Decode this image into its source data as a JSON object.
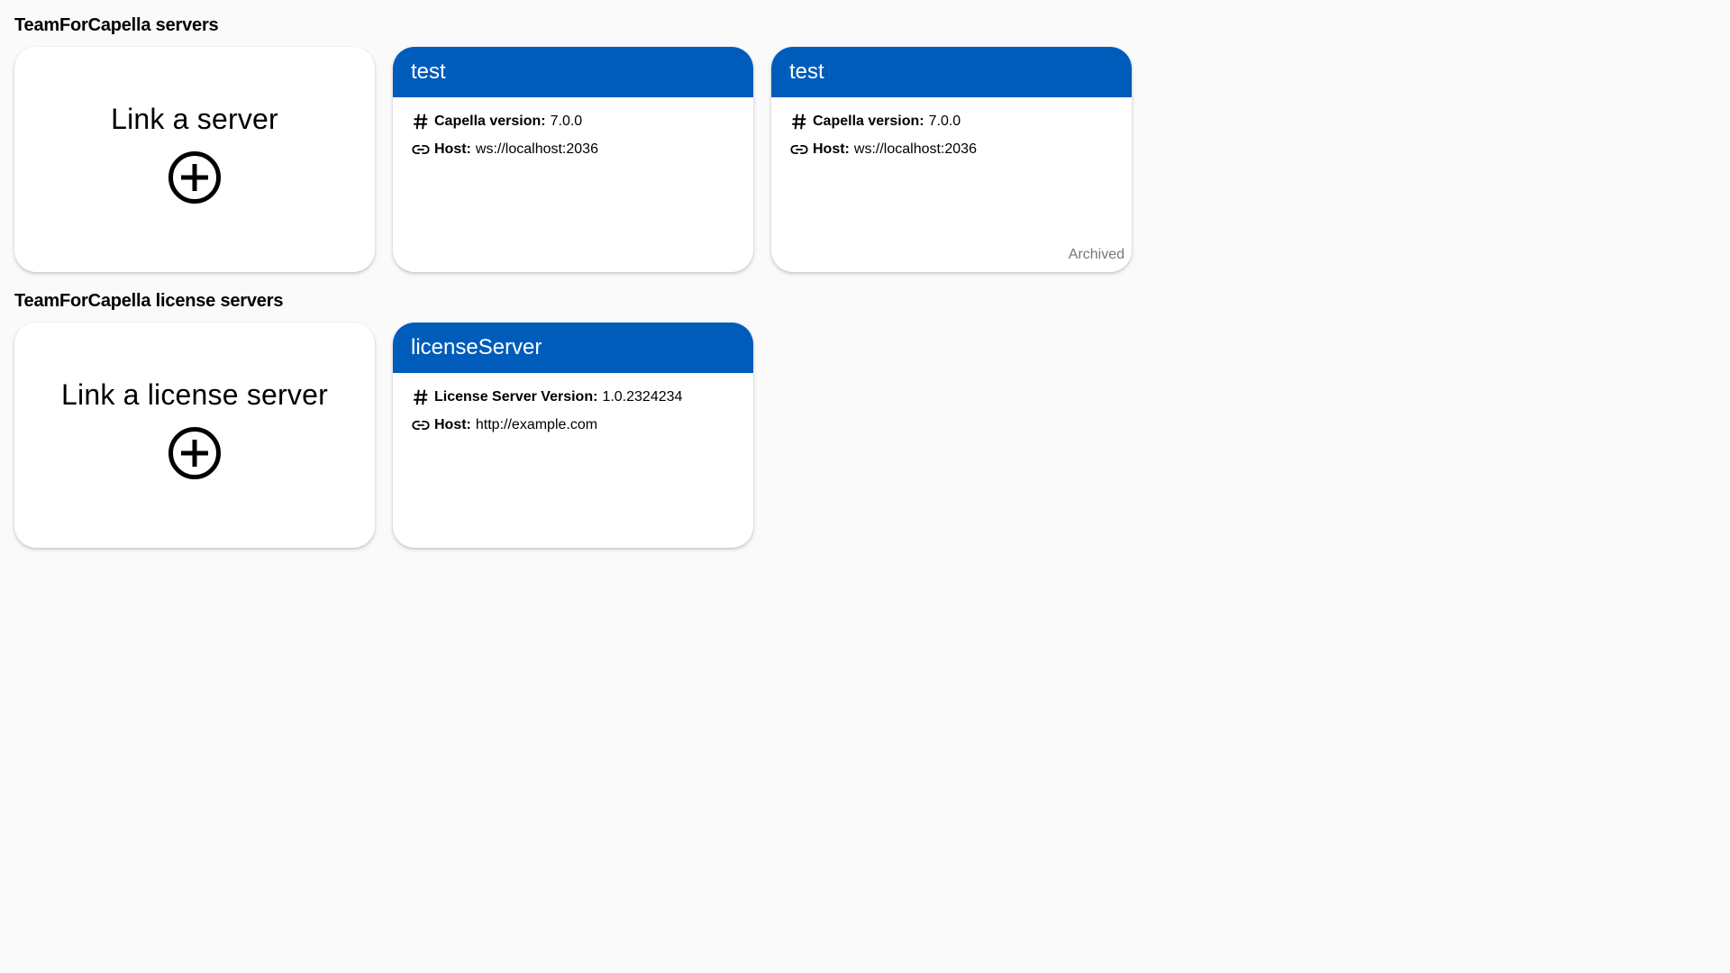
{
  "sections": {
    "servers": {
      "title": "TeamForCapella servers",
      "link_label": "Link a server",
      "cards": [
        {
          "name": "test",
          "version_key": "Capella version:",
          "version_value": "7.0.0",
          "host_key": "Host:",
          "host_value": "ws://localhost:2036"
        },
        {
          "name": "test",
          "version_key": "Capella version:",
          "version_value": "7.0.0",
          "host_key": "Host:",
          "host_value": "ws://localhost:2036",
          "status": "Archived"
        }
      ]
    },
    "license_servers": {
      "title": "TeamForCapella license servers",
      "link_label": "Link a license server",
      "cards": [
        {
          "name": "licenseServer",
          "version_key": "License Server Version:",
          "version_value": "1.0.2324234",
          "host_key": "Host:",
          "host_value": "http://example.com"
        }
      ]
    }
  },
  "icons": {
    "add": "add-circle-icon",
    "version": "hash-icon",
    "host": "link-icon"
  },
  "colors": {
    "card_header": "#005cbb",
    "background": "#fafafa",
    "archived_text": "#777777"
  }
}
